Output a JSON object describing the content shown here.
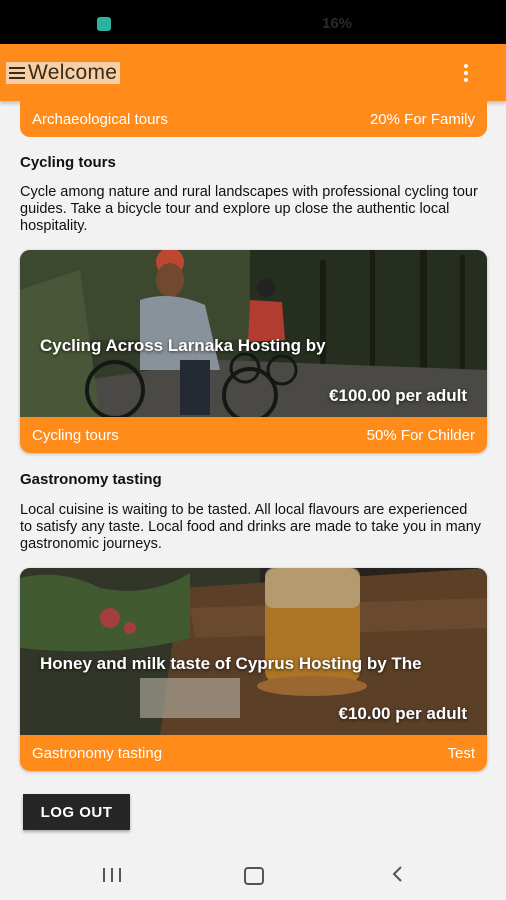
{
  "status_bar": {
    "battery_text": "16%"
  },
  "app_bar": {
    "title": "Welcome"
  },
  "top_card_footer": {
    "category": "Archaeological tours",
    "offer": "20% For Family"
  },
  "sections": [
    {
      "title": "Cycling tours",
      "description": "Cycle among nature and rural landscapes with professional cycling tour guides. Take a bicycle tour and explore up close the authentic local hospitality.",
      "card": {
        "title": "Cycling Across Larnaka Hosting by",
        "price": "€100.00 per adult",
        "category": "Cycling tours",
        "offer": "50% For Childer"
      }
    },
    {
      "title": "Gastronomy tasting",
      "description": "Local cuisine is waiting to be tasted. All local flavours are experienced to satisfy any taste. Local food and drinks are made to take you in many gastronomic journeys.",
      "card": {
        "title": "Honey and milk taste of Cyprus Hosting by The",
        "price": "€10.00 per adult",
        "category": "Gastronomy tasting",
        "offer": "Test"
      }
    }
  ],
  "logout_label": "LOG OUT",
  "colors": {
    "accent": "#ff8c1a",
    "button_dark": "#262626"
  },
  "icons": {
    "menu": "hamburger-icon",
    "overflow": "more-vert-icon"
  }
}
